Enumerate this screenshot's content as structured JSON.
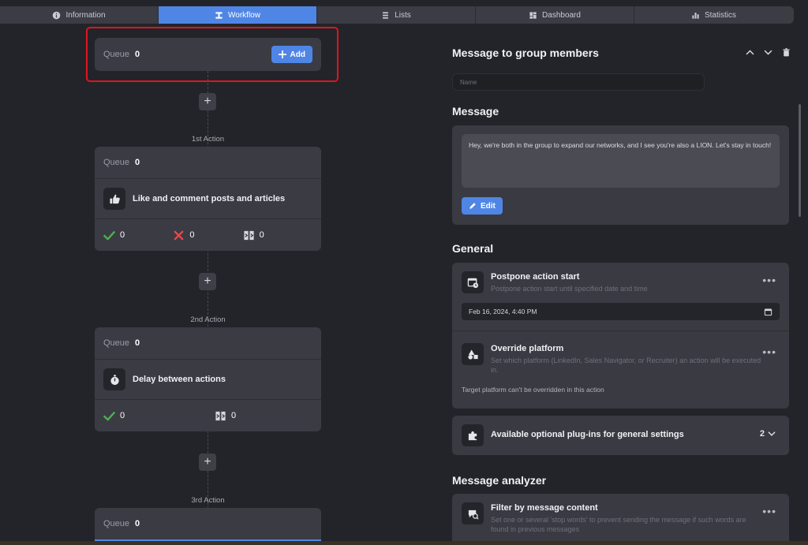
{
  "nav": {
    "tabs": [
      {
        "label": "Information",
        "icon": "info-icon"
      },
      {
        "label": "Workflow",
        "icon": "workflow-icon",
        "active": true
      },
      {
        "label": "Lists",
        "icon": "list-icon"
      },
      {
        "label": "Dashboard",
        "icon": "dashboard-icon"
      },
      {
        "label": "Statistics",
        "icon": "bar-chart-icon"
      }
    ]
  },
  "workflow": {
    "start": {
      "queue_label": "Queue",
      "queue_count": "0",
      "add_label": "Add"
    },
    "actions": [
      {
        "step_label": "1st Action",
        "queue_label": "Queue",
        "queue_count": "0",
        "name": "Like and comment posts and articles",
        "icon": "thumbs-up-icon",
        "success_count": "0",
        "failed_count": "0",
        "skipped_count": "0"
      },
      {
        "step_label": "2nd Action",
        "queue_label": "Queue",
        "queue_count": "0",
        "name": "Delay between actions",
        "icon": "stopwatch-icon",
        "success_count": "0",
        "skipped_count": "0"
      },
      {
        "step_label": "3rd Action",
        "queue_label": "Queue",
        "queue_count": "0"
      }
    ]
  },
  "panel": {
    "title": "Message to group members",
    "name_placeholder": "Name",
    "message": {
      "section_title": "Message",
      "text": "Hey, we're both in the group to expand our networks, and I see you're also a LION. Let's stay in touch!",
      "edit_label": "Edit"
    },
    "general": {
      "section_title": "General",
      "postpone": {
        "title": "Postpone action start",
        "description": "Postpone action start until specified date and time",
        "date_value": "Feb 16, 2024, 4:40 PM"
      },
      "override": {
        "title": "Override platform",
        "description": "Set which platform (LinkedIn, Sales Navigator, or Recruiter) an action will be executed in.",
        "note": "Target platform can't be overridden in this action"
      },
      "plugins": {
        "title": "Available optional plug-ins for general settings",
        "count": "2"
      }
    },
    "analyzer": {
      "section_title": "Message analyzer",
      "filter": {
        "title": "Filter by message content",
        "description": "Set one or several 'stop words' to prevent sending the message if such words are found in previous messages"
      }
    }
  },
  "colors": {
    "accent": "#4f86e6",
    "success": "#4caf50",
    "error": "#e5484d",
    "highlight": "#e0141e",
    "background": "#232429",
    "card": "#3a3b43"
  }
}
